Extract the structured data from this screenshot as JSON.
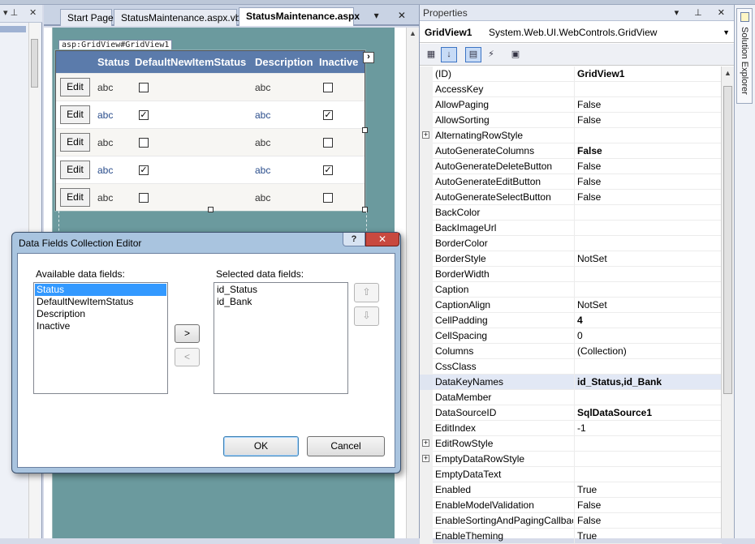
{
  "doc_tabs": [
    {
      "label": "Start Page"
    },
    {
      "label": "StatusMaintenance.aspx.vb"
    },
    {
      "label": "StatusMaintenance.aspx"
    }
  ],
  "doc_controls": "▾ ✕",
  "left_pane": {
    "pin": "▾ ⊥",
    "close": "✕"
  },
  "designer": {
    "tag_label": "asp:GridView#GridView1",
    "smart_tag": "›",
    "columns": [
      "Status",
      "DefaultNewItemStatus",
      "Description",
      "Inactive"
    ],
    "rows": [
      {
        "edit": "Edit",
        "status": "abc",
        "default_checked": "",
        "description": "abc",
        "inactive_checked": ""
      },
      {
        "edit": "Edit",
        "status": "abc",
        "default_checked": "✓",
        "description": "abc",
        "inactive_checked": "✓"
      },
      {
        "edit": "Edit",
        "status": "abc",
        "default_checked": "",
        "description": "abc",
        "inactive_checked": ""
      },
      {
        "edit": "Edit",
        "status": "abc",
        "default_checked": "✓",
        "description": "abc",
        "inactive_checked": "✓"
      },
      {
        "edit": "Edit",
        "status": "abc",
        "default_checked": "",
        "description": "abc",
        "inactive_checked": ""
      }
    ]
  },
  "properties": {
    "title": "Properties",
    "controls": "▾ ⊥ ✕",
    "object_name": "GridView1",
    "object_type": "System.Web.UI.WebControls.GridView",
    "toolbar": {
      "categorized": "▦",
      "alphabetical": "↓",
      "properties": "▤",
      "events": "⚡",
      "pages": "▣"
    },
    "rows": [
      {
        "name": "(ID)",
        "value": "GridView1",
        "bold": true,
        "expandable": false
      },
      {
        "name": "AccessKey",
        "value": "",
        "bold": false,
        "expandable": false
      },
      {
        "name": "AllowPaging",
        "value": "False",
        "bold": false,
        "expandable": false
      },
      {
        "name": "AllowSorting",
        "value": "False",
        "bold": false,
        "expandable": false
      },
      {
        "name": "AlternatingRowStyle",
        "value": "",
        "bold": false,
        "expandable": true
      },
      {
        "name": "AutoGenerateColumns",
        "value": "False",
        "bold": true,
        "expandable": false
      },
      {
        "name": "AutoGenerateDeleteButton",
        "value": "False",
        "bold": false,
        "expandable": false
      },
      {
        "name": "AutoGenerateEditButton",
        "value": "False",
        "bold": false,
        "expandable": false
      },
      {
        "name": "AutoGenerateSelectButton",
        "value": "False",
        "bold": false,
        "expandable": false
      },
      {
        "name": "BackColor",
        "value": "",
        "bold": false,
        "expandable": false
      },
      {
        "name": "BackImageUrl",
        "value": "",
        "bold": false,
        "expandable": false
      },
      {
        "name": "BorderColor",
        "value": "",
        "bold": false,
        "expandable": false
      },
      {
        "name": "BorderStyle",
        "value": "NotSet",
        "bold": false,
        "expandable": false
      },
      {
        "name": "BorderWidth",
        "value": "",
        "bold": false,
        "expandable": false
      },
      {
        "name": "Caption",
        "value": "",
        "bold": false,
        "expandable": false
      },
      {
        "name": "CaptionAlign",
        "value": "NotSet",
        "bold": false,
        "expandable": false
      },
      {
        "name": "CellPadding",
        "value": "4",
        "bold": true,
        "expandable": false
      },
      {
        "name": "CellSpacing",
        "value": "0",
        "bold": false,
        "expandable": false
      },
      {
        "name": "Columns",
        "value": "(Collection)",
        "bold": false,
        "expandable": false
      },
      {
        "name": "CssClass",
        "value": "",
        "bold": false,
        "expandable": false
      },
      {
        "name": "DataKeyNames",
        "value": "id_Status,id_Bank",
        "bold": true,
        "expandable": false,
        "selected": true
      },
      {
        "name": "DataMember",
        "value": "",
        "bold": false,
        "expandable": false
      },
      {
        "name": "DataSourceID",
        "value": "SqlDataSource1",
        "bold": true,
        "expandable": false
      },
      {
        "name": "EditIndex",
        "value": "-1",
        "bold": false,
        "expandable": false
      },
      {
        "name": "EditRowStyle",
        "value": "",
        "bold": false,
        "expandable": true
      },
      {
        "name": "EmptyDataRowStyle",
        "value": "",
        "bold": false,
        "expandable": true
      },
      {
        "name": "EmptyDataText",
        "value": "",
        "bold": false,
        "expandable": false
      },
      {
        "name": "Enabled",
        "value": "True",
        "bold": false,
        "expandable": false
      },
      {
        "name": "EnableModelValidation",
        "value": "False",
        "bold": false,
        "expandable": false
      },
      {
        "name": "EnableSortingAndPagingCallbacks",
        "value": "False",
        "bold": false,
        "expandable": false
      },
      {
        "name": "EnableTheming",
        "value": "True",
        "bold": false,
        "expandable": false
      }
    ]
  },
  "solution_explorer": {
    "label": "Solution Explorer"
  },
  "dialog": {
    "title": "Data Fields Collection Editor",
    "help": "?",
    "close": "✕",
    "available_label": "Available data fields:",
    "available_fields": [
      "Status",
      "DefaultNewItemStatus",
      "Description",
      "Inactive"
    ],
    "available_selected_index": 0,
    "selected_label": "Selected data fields:",
    "selected_fields": [
      "id_Status",
      "id_Bank"
    ],
    "add_button": ">",
    "remove_button": "<",
    "move_up": "⇧",
    "move_down": "⇩",
    "ok_button": "OK",
    "cancel_button": "Cancel"
  },
  "colors": {
    "design_surface": "#6b9a9e",
    "grid_header": "#5b7bab",
    "selection": "#3399ff",
    "dialog_frame": "#a9c4df",
    "close_button": "#c8493f"
  }
}
